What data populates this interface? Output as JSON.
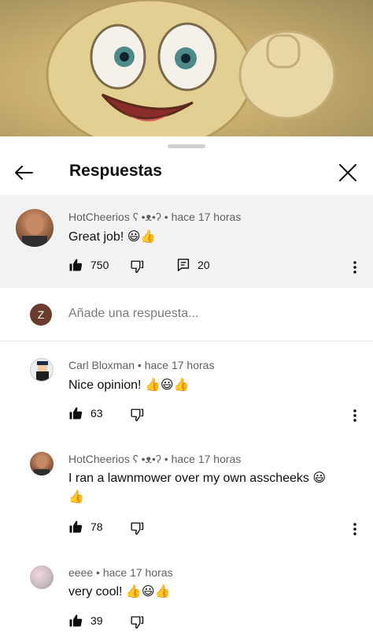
{
  "video": {
    "description_icon": "emoji-thumbs-up-character"
  },
  "header": {
    "title": "Respuestas"
  },
  "parent_comment": {
    "author": "HotCheerios ʕ •ᴥ•ʔ",
    "time": "hace 17 horas",
    "text": "Great job! 😃👍",
    "likes": "750",
    "replies": "20"
  },
  "reply_box": {
    "avatar_letter": "Z",
    "placeholder": "Añade una respuesta..."
  },
  "replies": [
    {
      "author": "Carl Bloxman",
      "time": "hace 17 horas",
      "text": "Nice opinion! 👍😃👍",
      "likes": "63"
    },
    {
      "author": "HotCheerios ʕ •ᴥ•ʔ",
      "time": "hace 17 horas",
      "text": "I ran a lawnmower over my own asscheeks 😃",
      "text2": "👍",
      "likes": "78"
    },
    {
      "author": "eeee",
      "time": "hace 17 horas",
      "text": "very cool! 👍😃👍",
      "likes": "39"
    }
  ],
  "separator": "•"
}
